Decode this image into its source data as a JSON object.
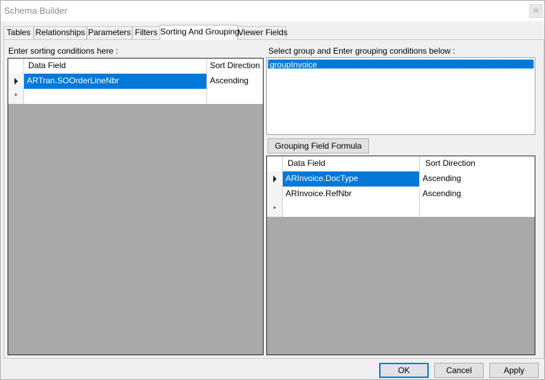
{
  "window": {
    "title": "Schema Builder",
    "close_symbol": "✕"
  },
  "tabs": [
    {
      "label": "Tables",
      "active": false
    },
    {
      "label": "Relationships",
      "active": false
    },
    {
      "label": "Parameters",
      "active": false
    },
    {
      "label": "Filters",
      "active": false
    },
    {
      "label": "Sorting And Grouping",
      "active": true
    },
    {
      "label": "Viewer Fields",
      "active": false
    }
  ],
  "sorting": {
    "label": "Enter sorting conditions here :",
    "columns": [
      "Data Field",
      "Sort Direction"
    ],
    "rows": [
      {
        "data_field": "ARTran.SOOrderLineNbr",
        "sort_direction": "Ascending",
        "selected": true
      }
    ],
    "new_row_symbol": "*"
  },
  "grouping": {
    "label": "Select group and Enter grouping conditions below :",
    "groups": [
      "groupInvoice"
    ],
    "selected_group": "groupInvoice",
    "formula_button": "Grouping Field Formula",
    "columns": [
      "Data Field",
      "Sort Direction"
    ],
    "rows": [
      {
        "data_field": "ARInvoice.DocType",
        "sort_direction": "Ascending",
        "selected": true
      },
      {
        "data_field": "ARInvoice.RefNbr",
        "sort_direction": "Ascending",
        "selected": false
      }
    ],
    "new_row_symbol": "*"
  },
  "footer": {
    "ok": "OK",
    "cancel": "Cancel",
    "apply": "Apply"
  },
  "colors": {
    "selection": "#0078d7",
    "grid_empty": "#a9a9a9",
    "window_bg": "#f0f0f0"
  },
  "icons": {
    "current_row": "triangle-right-icon",
    "new_row": "asterisk-icon",
    "close": "close-icon"
  }
}
